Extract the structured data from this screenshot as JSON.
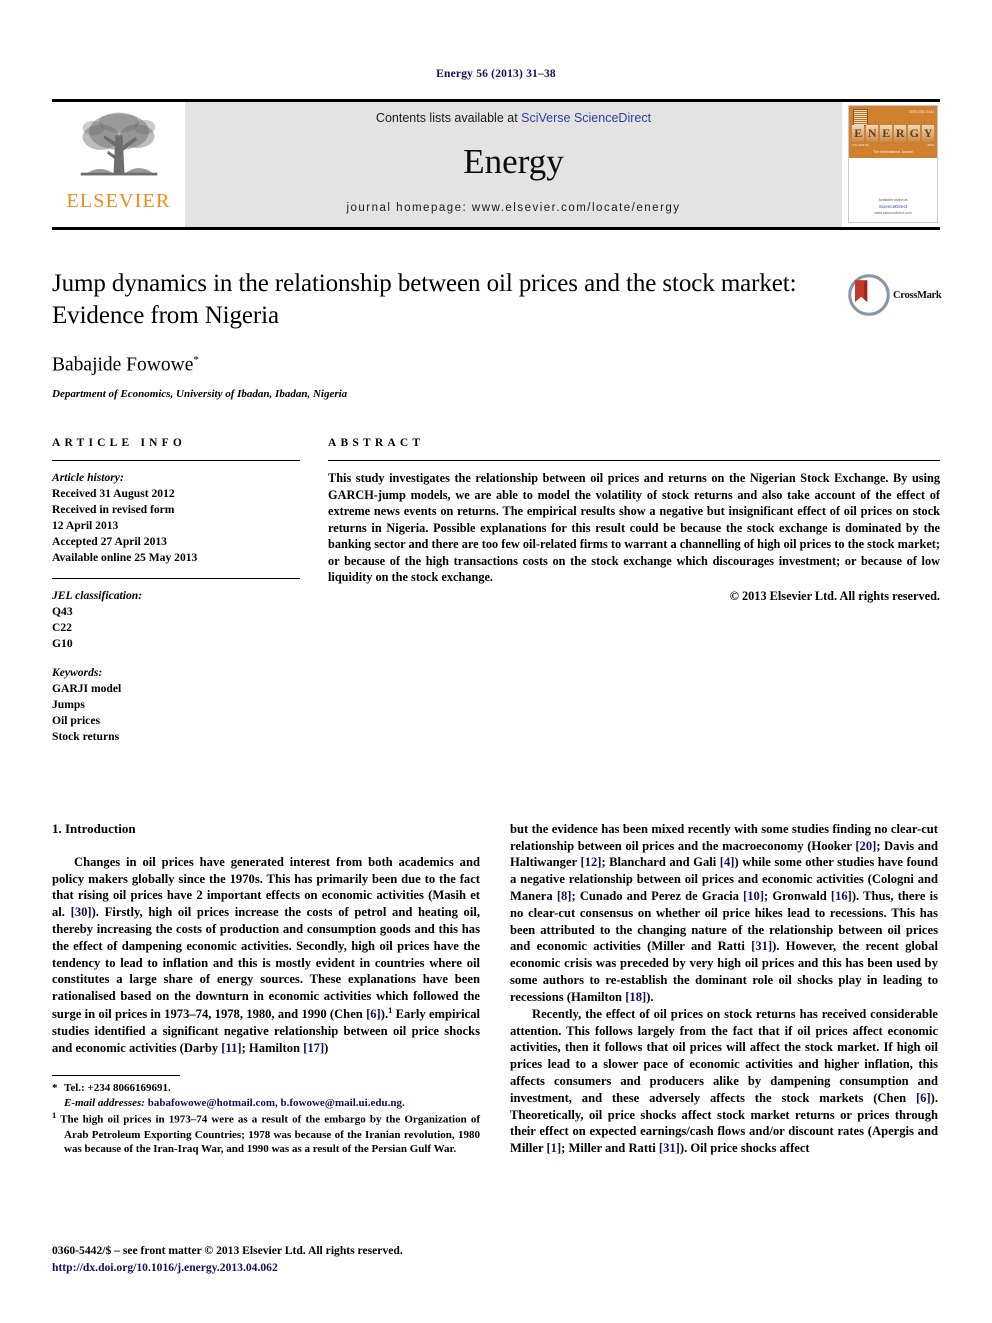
{
  "running_head": "Energy 56 (2013) 31–38",
  "masthead": {
    "publisher_name": "ELSEVIER",
    "contents_prefix": "Contents lists available at ",
    "contents_link": "SciVerse ScienceDirect",
    "journal_title": "Energy",
    "homepage": "journal homepage: www.elsevier.com/locate/energy",
    "cover": {
      "issue_label": "ISSN 0360-5442",
      "letters": [
        "E",
        "N",
        "E",
        "R",
        "G",
        "Y"
      ],
      "sub_left": "VOLUME 56",
      "sub_right": "2013",
      "tagline": "The International Journal",
      "footer_note": "Available online at",
      "footer_brand": "ScienceDirect",
      "footer_url": "www.sciencedirect.com"
    }
  },
  "article": {
    "title": "Jump dynamics in the relationship between oil prices and the stock market: Evidence from Nigeria",
    "author": "Babajide Fowowe",
    "author_marker": "*",
    "affiliation": "Department of Economics, University of Ibadan, Ibadan, Nigeria",
    "crossmark_label": "CrossMark"
  },
  "article_info": {
    "heading": "ARTICLE INFO",
    "history_label": "Article history:",
    "history": [
      "Received 31 August 2012",
      "Received in revised form",
      "12 April 2013",
      "Accepted 27 April 2013",
      "Available online 25 May 2013"
    ],
    "jel_label": "JEL classification:",
    "jel": [
      "Q43",
      "C22",
      "G10"
    ],
    "keywords_label": "Keywords:",
    "keywords": [
      "GARJI model",
      "Jumps",
      "Oil prices",
      "Stock returns"
    ]
  },
  "abstract": {
    "heading": "ABSTRACT",
    "text": "This study investigates the relationship between oil prices and returns on the Nigerian Stock Exchange. By using GARCH-jump models, we are able to model the volatility of stock returns and also take account of the effect of extreme news events on returns. The empirical results show a negative but insignificant effect of oil prices on stock returns in Nigeria. Possible explanations for this result could be because the stock exchange is dominated by the banking sector and there are too few oil-related firms to warrant a channelling of high oil prices to the stock market; or because of the high transactions costs on the stock exchange which discourages investment; or because of low liquidity on the stock exchange.",
    "copyright": "© 2013 Elsevier Ltd. All rights reserved."
  },
  "body": {
    "section_number_title": "1. Introduction",
    "left_paragraphs": [
      "Changes in oil prices have generated interest from both academics and policy makers globally since the 1970s. This has primarily been due to the fact that rising oil prices have 2 important effects on economic activities (Masih et al. [30]). Firstly, high oil prices increase the costs of petrol and heating oil, thereby increasing the costs of production and consumption goods and this has the effect of dampening economic activities. Secondly, high oil prices have the tendency to lead to inflation and this is mostly evident in countries where oil constitutes a large share of energy sources. These explanations have been rationalised based on the downturn in economic activities which followed the surge in oil prices in 1973–74, 1978, 1980, and 1990 (Chen [6]).¹ Early empirical studies identified a significant negative relationship between oil price shocks and economic activities (Darby [11]; Hamilton [17])"
    ],
    "right_paragraphs": [
      "but the evidence has been mixed recently with some studies finding no clear-cut relationship between oil prices and the macroeconomy (Hooker [20]; Davis and Haltiwanger [12]; Blanchard and Gali [4]) while some other studies have found a negative relationship between oil prices and economic activities (Cologni and Manera [8]; Cunado and Perez de Gracia [10]; Gronwald [16]). Thus, there is no clear-cut consensus on whether oil price hikes lead to recessions. This has been attributed to the changing nature of the relationship between oil prices and economic activities (Miller and Ratti [31]). However, the recent global economic crisis was preceded by very high oil prices and this has been used by some authors to re-establish the dominant role oil shocks play in leading to recessions (Hamilton [18]).",
      "Recently, the effect of oil prices on stock returns has received considerable attention. This follows largely from the fact that if oil prices affect economic activities, then it follows that oil prices will affect the stock market. If high oil prices lead to a slower pace of economic activities and higher inflation, this affects consumers and producers alike by dampening consumption and investment, and these adversely affects the stock markets (Chen [6]). Theoretically, oil price shocks affect stock market returns or prices through their effect on expected earnings/cash flows and/or discount rates (Apergis and Miller [1]; Miller and Ratti [31]). Oil price shocks affect"
    ]
  },
  "footnotes": {
    "tel_marker": "*",
    "tel": "Tel.: +234 8066169691.",
    "email_label": "E-mail addresses:",
    "emails": "babafowowe@hotmail.com, b.fowowe@mail.ui.edu.ng.",
    "note_marker": "1",
    "note": "The high oil prices in 1973–74 were as a result of the embargo by the Organization of Arab Petroleum Exporting Countries; 1978 was because of the Iranian revolution, 1980 was because of the Iran-Iraq War, and 1990 was as a result of the Persian Gulf War."
  },
  "page_footer": {
    "issn_line": "0360-5442/$ – see front matter © 2013 Elsevier Ltd. All rights reserved.",
    "doi": "http://dx.doi.org/10.1016/j.energy.2013.04.062"
  },
  "colors": {
    "navy": "#10105e",
    "link_blue": "#2b3f9c",
    "elsevier_orange": "#f08a1b",
    "cover_orange": "#d0812f",
    "masthead_grey": "#e3e3e3"
  }
}
